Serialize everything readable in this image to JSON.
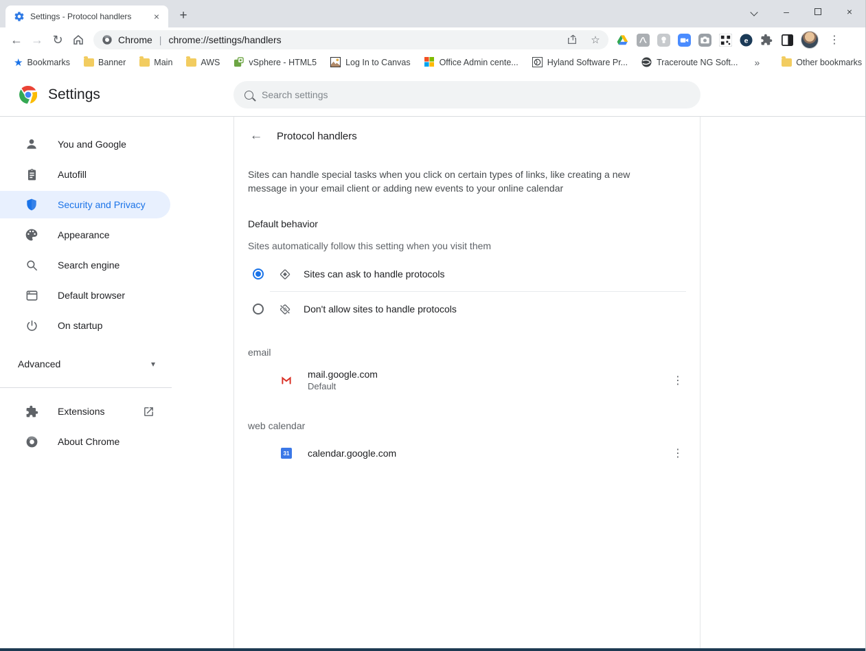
{
  "window": {
    "tab_title": "Settings - Protocol handlers",
    "new_tab_label": "+",
    "controls": {
      "minimize": "–",
      "close_window": "×",
      "close_tab": "×"
    }
  },
  "toolbar": {
    "nav": {
      "back": "←",
      "forward": "→",
      "refresh": "↻"
    },
    "omnibox": {
      "site_name": "Chrome",
      "separator": "|",
      "url": "chrome://settings/handlers",
      "bookmark_star": "☆"
    },
    "overflow_dots": "⋮",
    "extension_icons": [
      "drive-icon",
      "acrobat-icon",
      "disabled-extension-icon",
      "zoom-icon",
      "camera-icon",
      "qr-scanner-icon",
      "e-badge-icon",
      "puzzle-icon",
      "reader-panel-icon"
    ],
    "e_badge_letter": "e"
  },
  "bookmarks_bar": {
    "star_glyph": "★",
    "items": [
      {
        "label": "Bookmarks",
        "icon": "star"
      },
      {
        "label": "Banner",
        "icon": "folder"
      },
      {
        "label": "Main",
        "icon": "folder"
      },
      {
        "label": "AWS",
        "icon": "folder"
      },
      {
        "label": "vSphere - HTML5",
        "icon": "vsphere"
      },
      {
        "label": "Log In to Canvas",
        "icon": "canvas"
      },
      {
        "label": "Office Admin cente...",
        "icon": "office"
      },
      {
        "label": "Hyland Software Pr...",
        "icon": "hyland"
      },
      {
        "label": "Traceroute NG Soft...",
        "icon": "globe"
      }
    ],
    "overflow_chevron": "»",
    "other_bookmarks": {
      "label": "Other bookmarks",
      "icon": "folder"
    }
  },
  "settings_header": {
    "title": "Settings",
    "search_placeholder": "Search settings"
  },
  "sidebar": {
    "items": [
      {
        "label": "You and Google",
        "icon": "person-icon",
        "selected": false
      },
      {
        "label": "Autofill",
        "icon": "autofill-icon",
        "selected": false
      },
      {
        "label": "Security and Privacy",
        "icon": "shield-icon",
        "selected": true
      },
      {
        "label": "Appearance",
        "icon": "palette-icon",
        "selected": false
      },
      {
        "label": "Search engine",
        "icon": "search-icon",
        "selected": false
      },
      {
        "label": "Default browser",
        "icon": "browser-icon",
        "selected": false
      },
      {
        "label": "On startup",
        "icon": "power-icon",
        "selected": false
      }
    ],
    "advanced": {
      "label": "Advanced",
      "caret": "▾"
    },
    "footer_items": [
      {
        "label": "Extensions",
        "icon": "puzzle-icon",
        "has_launch_icon": true
      },
      {
        "label": "About Chrome",
        "icon": "chrome-gray-icon",
        "has_launch_icon": false
      }
    ]
  },
  "main": {
    "back_glyph": "←",
    "page_title": "Protocol handlers",
    "description": "Sites can handle special tasks when you click on certain types of links, like creating a new message in your email client or adding new events to your online calendar",
    "default_behavior": {
      "heading": "Default behavior",
      "subtext": "Sites automatically follow this setting when you visit them",
      "options": [
        {
          "label": "Sites can ask to handle protocols",
          "selected": true,
          "icon": "protocol-handler-icon"
        },
        {
          "label": "Don't allow sites to handle protocols",
          "selected": false,
          "icon": "protocol-handler-blocked-icon"
        }
      ]
    },
    "sections": [
      {
        "label": "email",
        "entries": [
          {
            "site": "mail.google.com",
            "note": "Default",
            "icon": "gmail-icon",
            "menu_glyph": "⋮"
          }
        ]
      },
      {
        "label": "web calendar",
        "entries": [
          {
            "site": "calendar.google.com",
            "note": "",
            "icon": "calendar-icon",
            "icon_text": "31",
            "menu_glyph": "⋮"
          }
        ]
      }
    ]
  },
  "colors": {
    "accent_blue": "#1A73E8",
    "selected_item_bg": "#E8F0FE",
    "frame_gray": "#DEE1E6",
    "pill_gray": "#F1F3F4",
    "primary_text": "#202124",
    "secondary_text": "#5F6368",
    "gmail_red": "#D93025",
    "calendar_blue": "#3B78E7",
    "bottom_edge": "#1D3A52"
  }
}
